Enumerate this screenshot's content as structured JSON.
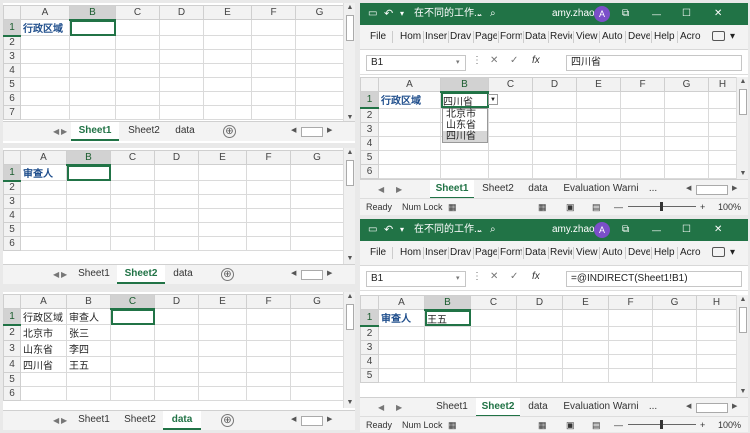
{
  "columns_left": [
    "A",
    "B",
    "C",
    "D",
    "E",
    "F",
    "G"
  ],
  "columns_right": [
    "A",
    "B",
    "C",
    "D",
    "E",
    "F",
    "G",
    "H"
  ],
  "row_numbers": [
    "1",
    "2",
    "3",
    "4",
    "5",
    "6",
    "7"
  ],
  "sheet_tabs": [
    "Sheet1",
    "Sheet2",
    "data"
  ],
  "sheet_tabs_right": [
    "Sheet1",
    "Sheet2",
    "data",
    "Evaluation Warni",
    "..."
  ],
  "add_sheet": "⊕",
  "pane1": {
    "a1": "行政区域"
  },
  "pane2": {
    "a1": "审查人"
  },
  "pane3": {
    "rows": [
      [
        "行政区域",
        "审查人"
      ],
      [
        "北京市",
        "张三"
      ],
      [
        "山东省",
        "李四"
      ],
      [
        "四川省",
        "王五"
      ]
    ]
  },
  "window": {
    "title": "在不同的工作...",
    "user": "amy.zhao",
    "avatar": "A",
    "ribbon_tabs": [
      "File",
      "Hom",
      "Inser",
      "Drav",
      "Page",
      "Form",
      "Data",
      "Revie",
      "View",
      "Auto",
      "Deve",
      "Help",
      "Acro"
    ],
    "minimize": "—",
    "restore": "☐",
    "close": "✕"
  },
  "win1": {
    "name_box": "B1",
    "fx": "fx",
    "formula": "四川省",
    "a1": "行政区域",
    "b1": "四川省",
    "dropdown_options": [
      "北京市",
      "山东省",
      "四川省"
    ]
  },
  "win2": {
    "name_box": "B1",
    "fx": "fx",
    "formula": "=@INDIRECT(Sheet1!B1)",
    "a1": "审查人",
    "b1": "王五"
  },
  "status": {
    "ready": "Ready",
    "numlock": "Num Lock",
    "zoom": "100%",
    "minus": "—",
    "plus": "+"
  },
  "colors": {
    "excel_green": "#217346",
    "blue_text": "#1f4e8c",
    "avatar": "#7b4fc9"
  }
}
